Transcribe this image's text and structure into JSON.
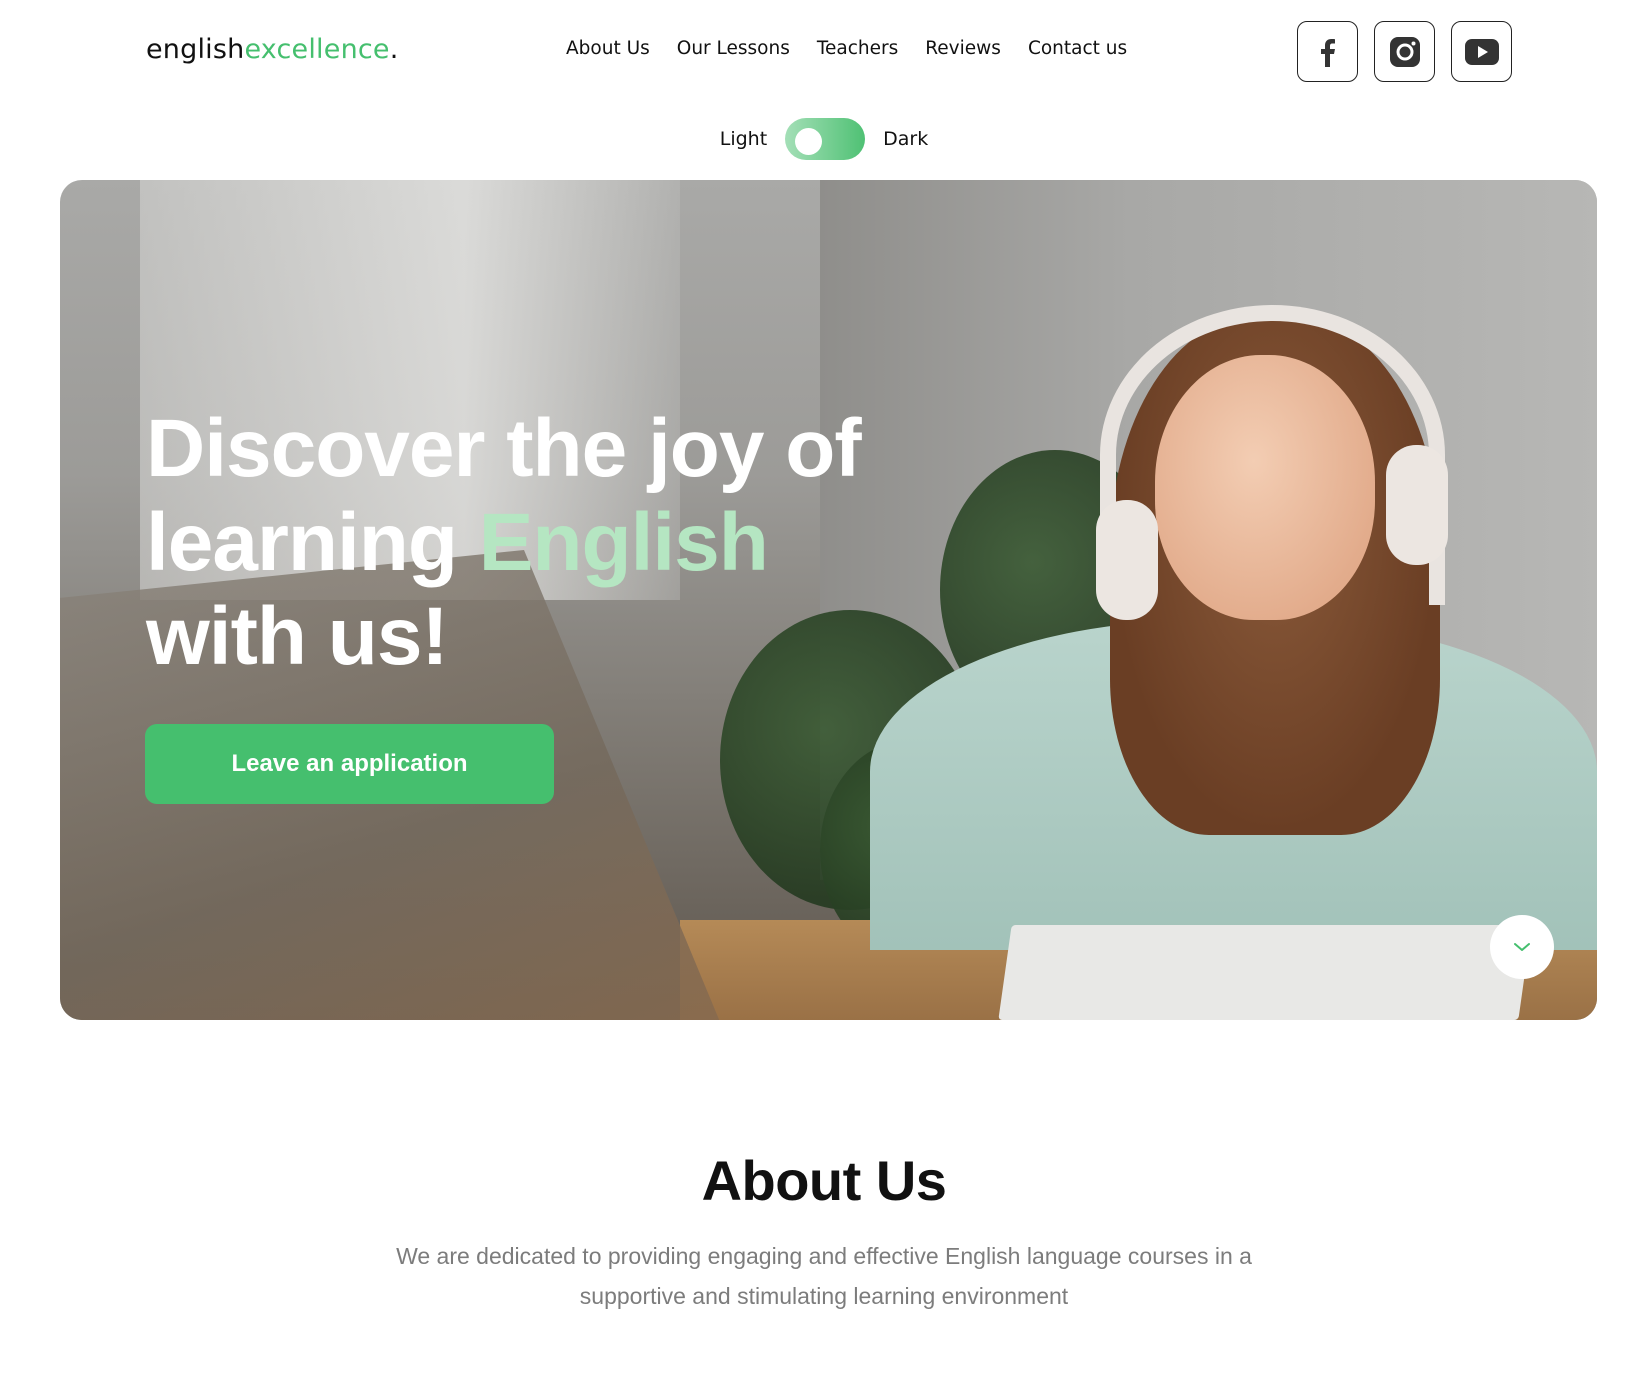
{
  "header": {
    "logo": {
      "part1": "english",
      "part2": "excellence",
      "part3": "."
    },
    "nav": [
      "About Us",
      "Our Lessons",
      "Teachers",
      "Reviews",
      "Contact us"
    ],
    "socials": [
      {
        "icon": "facebook-icon"
      },
      {
        "icon": "instagram-icon"
      },
      {
        "icon": "youtube-icon"
      }
    ]
  },
  "theme_toggle": {
    "left_label": "Light",
    "right_label": "Dark",
    "state": "light"
  },
  "hero": {
    "title_line1": "Discover the joy of",
    "title_line2_start": "learning ",
    "title_highlight": "English",
    "title_line3": "with us!",
    "cta_label": "Leave an application",
    "scroll_icon": "chevron-down-icon"
  },
  "about": {
    "title_start": "About ",
    "title_highlight": "Us",
    "text": "We are dedicated to providing engaging and effective English language courses in a supportive and stimulating learning environment"
  },
  "colors": {
    "accent": "#45bf6e",
    "accent_light": "#b5e6c2",
    "text": "#111111",
    "muted_text": "#7c7c7c"
  }
}
